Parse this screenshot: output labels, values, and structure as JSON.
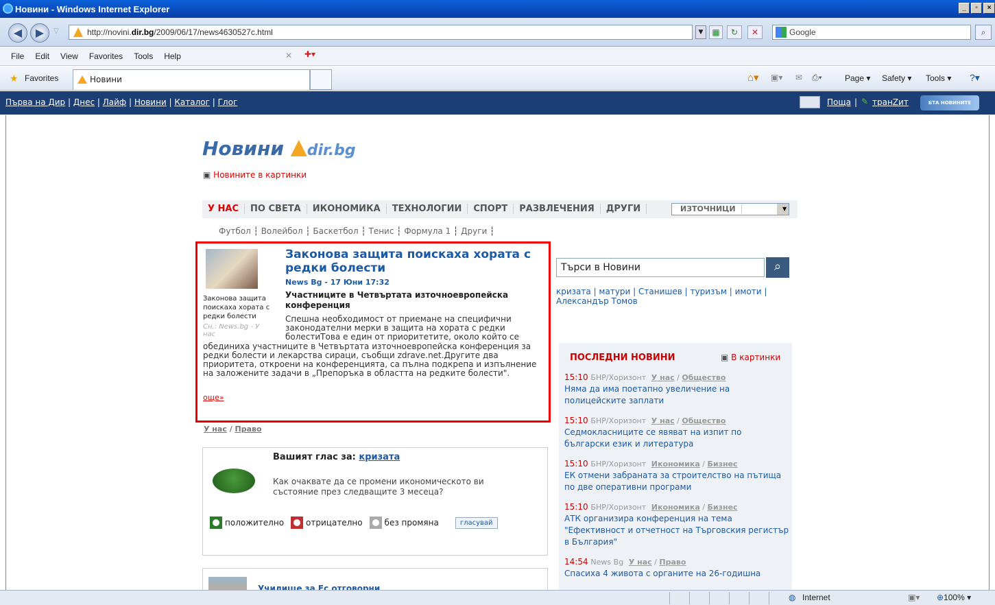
{
  "window": {
    "title": "Новини - Windows Internet Explorer",
    "min_label": "_",
    "max_label": "▫",
    "close_label": "×"
  },
  "address": {
    "url_prefix": "http://novini.",
    "url_domain": "dir.bg",
    "url_suffix": "/2009/06/17/news4630527c.html",
    "search_placeholder": "Google"
  },
  "menu": [
    "File",
    "Edit",
    "View",
    "Favorites",
    "Tools",
    "Help"
  ],
  "favorites_label": "Favorites",
  "tab_label": "Новини",
  "commandbar": {
    "page": "Page ▾",
    "safety": "Safety ▾",
    "tools": "Tools ▾"
  },
  "dirbar": {
    "links": [
      "Първа на Дир",
      "Днес",
      "Лайф",
      "Новини",
      "Каталог",
      "Глог"
    ],
    "mail": "Поща",
    "tranzit": "транZит",
    "bta": "БТА НОВИНИТЕ"
  },
  "logo": {
    "word": "Новини",
    "brand": "dir.bg"
  },
  "pictures_link": "Новините в картинки",
  "categories": [
    "У НАС",
    "ПО СВЕТА",
    "ИКОНОМИКА",
    "ТЕХНОЛОГИИ",
    "СПОРТ",
    "РАЗВЛЕЧЕНИЯ",
    "ДРУГИ"
  ],
  "sources_select": "ИЗТОЧНИЦИ",
  "subcategories": [
    "Футбол",
    "Волейбол",
    "Баскетбол",
    "Тенис",
    "Формула 1",
    "Други"
  ],
  "article": {
    "title": "Законова защита поискаха хората с редки болести",
    "source_date": "News Bg - 17 Юни 17:32",
    "caption": "Законова защита поискаха хората с редки болести",
    "credit": "Сн.: News.bg - У нас",
    "subtitle": "Участниците в Четвъртата източноевропейска конференция",
    "body": "Спешна необходимост от приемане на специфични законодателни мерки в защита на хората с редки болестиТова е един от приоритетите, около който се обединиха участниците в Четвъртата източноевропейска конференция за редки болести и лекарства сираци, съобщи zdrave.net.Другите два приоритета, откроени на конференцията, са пълна подкрепа и изпълнение на заложените задачи в „Препоръка в областта на редките болести\".",
    "more": "още»",
    "cat1": "У нас",
    "cat2": "Право"
  },
  "search": {
    "placeholder": "Търси в Новини"
  },
  "tags": [
    "кризата",
    "матури",
    "Станишев",
    "туризъм",
    "имоти",
    "Александър Томов"
  ],
  "poll": {
    "prompt": "Вашият глас за:",
    "topic": "кризата",
    "question": "Как очаквате да се промени икономическото ви състояние през следващите 3 месеца?",
    "options": [
      "положително",
      "отрицателно",
      "без промяна"
    ],
    "vote": "гласувай"
  },
  "latest": {
    "heading": "ПОСЛЕДНИ НОВИНИ",
    "pictures": "В картинки",
    "items": [
      {
        "time": "15:10",
        "source": "БНР/Хоризонт",
        "cat": "У нас",
        "sub": "Общество",
        "title": "Няма да има поетапно увеличение на полицейските заплати"
      },
      {
        "time": "15:10",
        "source": "БНР/Хоризонт",
        "cat": "У нас",
        "sub": "Общество",
        "title": "Седмокласниците се явяват на изпит по български език и литература"
      },
      {
        "time": "15:10",
        "source": "БНР/Хоризонт",
        "cat": "Икономика",
        "sub": "Бизнес",
        "title": "ЕК отмени забраната за строителство на пътища по две оперативни програми"
      },
      {
        "time": "15:10",
        "source": "БНР/Хоризонт",
        "cat": "Икономика",
        "sub": "Бизнес",
        "title": "АТК организира конференция на тема \"Ефективност и отчетност на Търговския регистър в България\""
      },
      {
        "time": "14:54",
        "source": "News Bg",
        "cat": "У нас",
        "sub": "Право",
        "title": "Спасиха 4 живота с органите на 26-годишна"
      }
    ]
  },
  "promo_text": "Училище за Ес отговорни",
  "status": {
    "zone": "Internet",
    "zoom": "100%"
  }
}
